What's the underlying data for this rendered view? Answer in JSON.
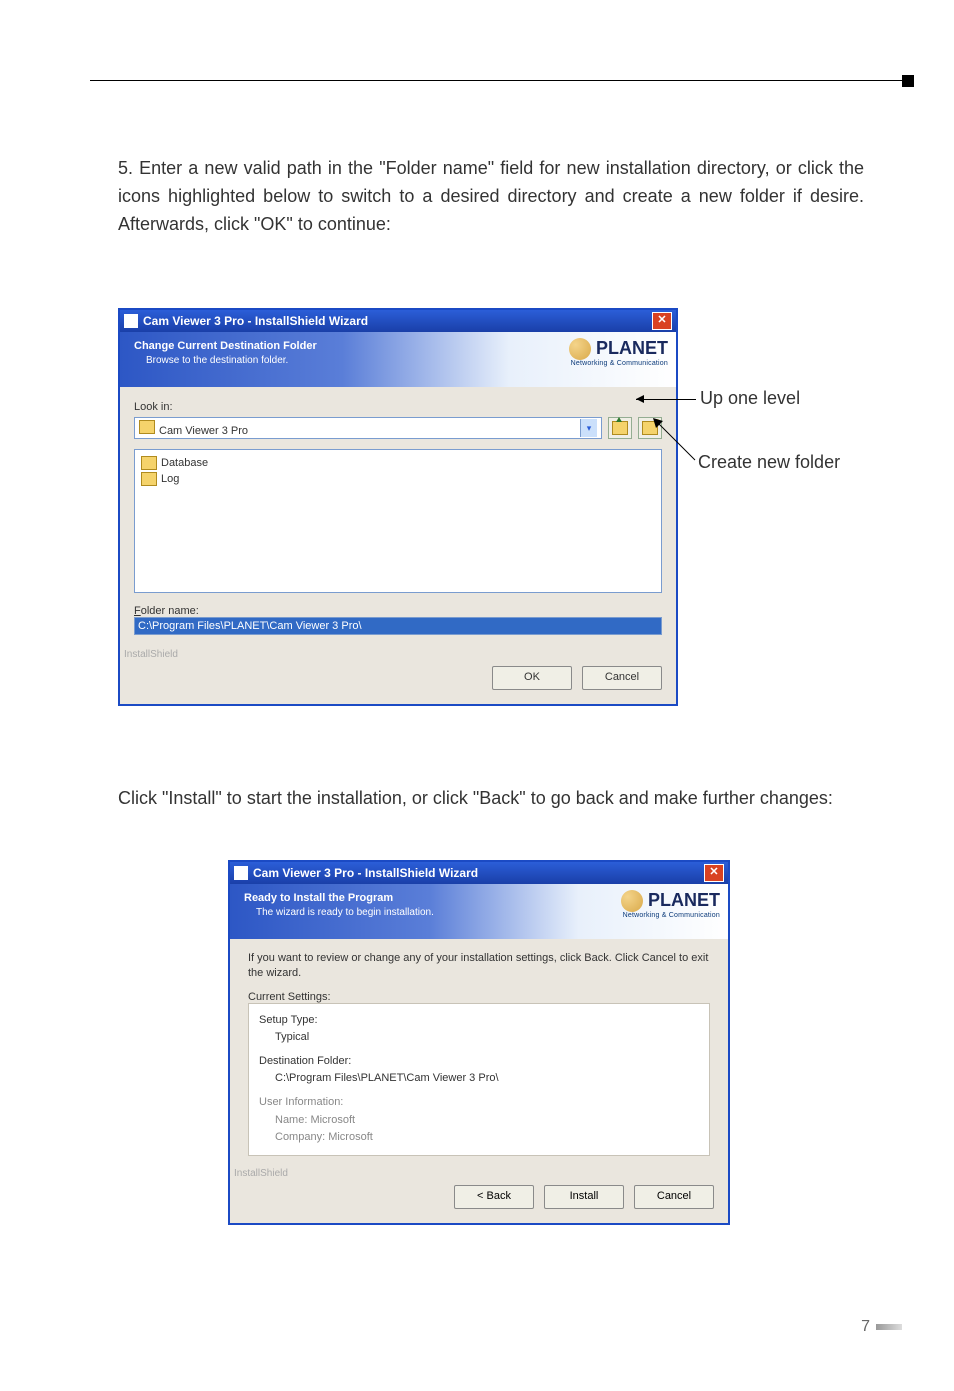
{
  "step5_text": "5. Enter a new valid path in the \"Folder name\" field for new installation directory, or click the icons highlighted below to switch to a desired directory and create a new folder if desire. Afterwards, click \"OK\" to continue:",
  "click_install_text": "Click \"Install\" to start the installation, or click \"Back\" to go back and make further changes:",
  "annotations": {
    "up_one_level": "Up one level",
    "create_new_folder": "Create new folder"
  },
  "dialog1": {
    "window_title": "Cam Viewer 3 Pro - InstallShield Wizard",
    "banner_title": "Change Current Destination Folder",
    "banner_sub": "Browse to the destination folder.",
    "logo_text": "PLANET",
    "logo_tag": "Networking & Communication",
    "look_in_label": "Look in:",
    "look_in_value": "Cam Viewer 3 Pro",
    "file_items": [
      "Database",
      "Log"
    ],
    "folder_name_label": "Folder name:",
    "folder_name_value": "C:\\Program Files\\PLANET\\Cam Viewer 3 Pro\\",
    "installshield_label": "InstallShield",
    "ok_label": "OK",
    "cancel_label": "Cancel"
  },
  "dialog2": {
    "window_title": "Cam Viewer 3 Pro - InstallShield Wizard",
    "banner_title": "Ready to Install the Program",
    "banner_sub": "The wizard is ready to begin installation.",
    "logo_text": "PLANET",
    "logo_tag": "Networking & Communication",
    "info_text": "If you want to review or change any of your installation settings, click Back. Click Cancel to exit the wizard.",
    "current_settings_label": "Current Settings:",
    "setup_type_label": "Setup Type:",
    "setup_type_value": "Typical",
    "dest_folder_label": "Destination Folder:",
    "dest_folder_value": "C:\\Program Files\\PLANET\\Cam Viewer 3 Pro\\",
    "user_info_label": "User Information:",
    "user_name": "Name: Microsoft",
    "user_company": "Company: Microsoft",
    "installshield_label": "InstallShield",
    "back_label": "< Back",
    "install_label": "Install",
    "cancel_label": "Cancel"
  },
  "page_number": "7"
}
